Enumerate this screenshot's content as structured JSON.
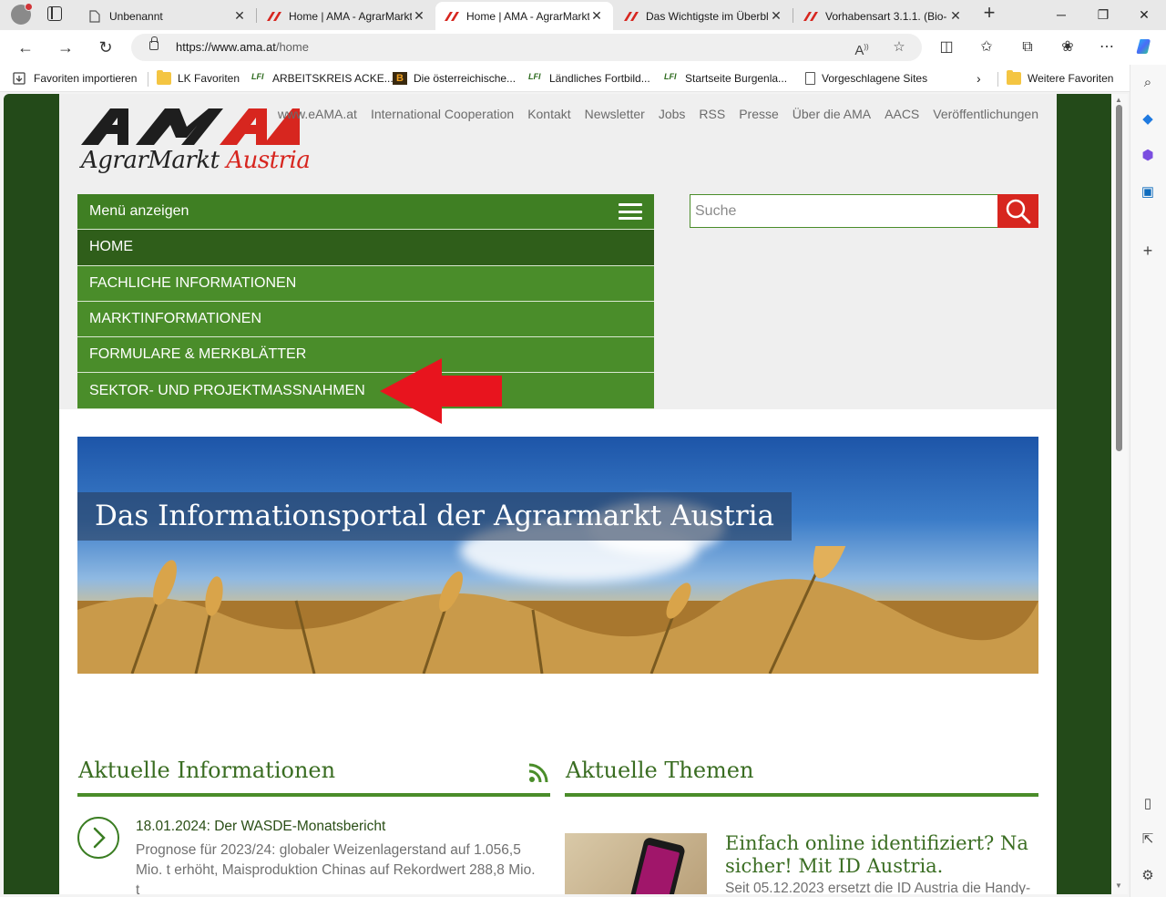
{
  "browser": {
    "tabs": [
      {
        "title": "Unbenannt",
        "active": false
      },
      {
        "title": "Home | AMA - AgrarMarkt",
        "active": false
      },
      {
        "title": "Home | AMA - AgrarMarkt",
        "active": true
      },
      {
        "title": "Das Wichtigste im Überblick",
        "active": false
      },
      {
        "title": "Vorhabensart 3.1.1. (Bio-",
        "active": false
      }
    ],
    "close_glyph": "✕",
    "new_tab_glyph": "+",
    "url_host": "https://www.ama.at",
    "url_path": "/home",
    "favorites": [
      {
        "label": "Favoriten importieren",
        "icon": "import-icon"
      },
      {
        "label": "LK Favoriten",
        "icon": "folder-icon"
      },
      {
        "label": "ARBEITSKREIS ACKE...",
        "icon": "lfi-icon"
      },
      {
        "label": "Die österreichische...",
        "icon": "b-icon"
      },
      {
        "label": "Ländliches Fortbild...",
        "icon": "lfi-icon"
      },
      {
        "label": "Startseite Burgenla...",
        "icon": "lfi-icon"
      },
      {
        "label": "Vorgeschlagene Sites",
        "icon": "page-icon"
      },
      {
        "label": "Weitere Favoriten",
        "icon": "folder-icon"
      }
    ],
    "lfi_text": "LFI",
    "b_text": "B",
    "accent": "#0f6cbd"
  },
  "site": {
    "logo_word1": "AgrarMarkt",
    "logo_word2": "Austria",
    "topnav": [
      "www.eAMA.at",
      "International Cooperation",
      "Kontakt",
      "Newsletter",
      "Jobs",
      "RSS",
      "Presse",
      "Über die AMA",
      "AACS",
      "Veröffentlichungen"
    ],
    "menu_toggle": "Menü anzeigen",
    "menu": [
      "HOME",
      "FACHLICHE INFORMATIONEN",
      "MARKTINFORMATIONEN",
      "FORMULARE & MERKBLÄTTER",
      "SEKTOR- UND PROJEKTMASSNAHMEN"
    ],
    "search_placeholder": "Suche",
    "hero_title": "Das Informationsportal der Agrarmarkt Austria",
    "news_heading": "Aktuelle Informationen",
    "themes_heading": "Aktuelle Themen",
    "news": [
      {
        "date": "18.01.2024: Der WASDE-Monatsbericht",
        "text": "Prognose für 2023/24: globaler Weizenlagerstand auf 1.056,5 Mio. t erhöht, Maisproduktion Chinas auf Rekordwert 288,8 Mio. t"
      }
    ],
    "themes": [
      {
        "title": "Einfach online identifiziert? Na sicher! Mit ID Austria.",
        "text": "Seit 05.12.2023 ersetzt die ID Austria die Handy-"
      }
    ],
    "colors": {
      "green_dark": "#234a19",
      "green": "#4a8d2a",
      "red": "#d7261f"
    }
  }
}
